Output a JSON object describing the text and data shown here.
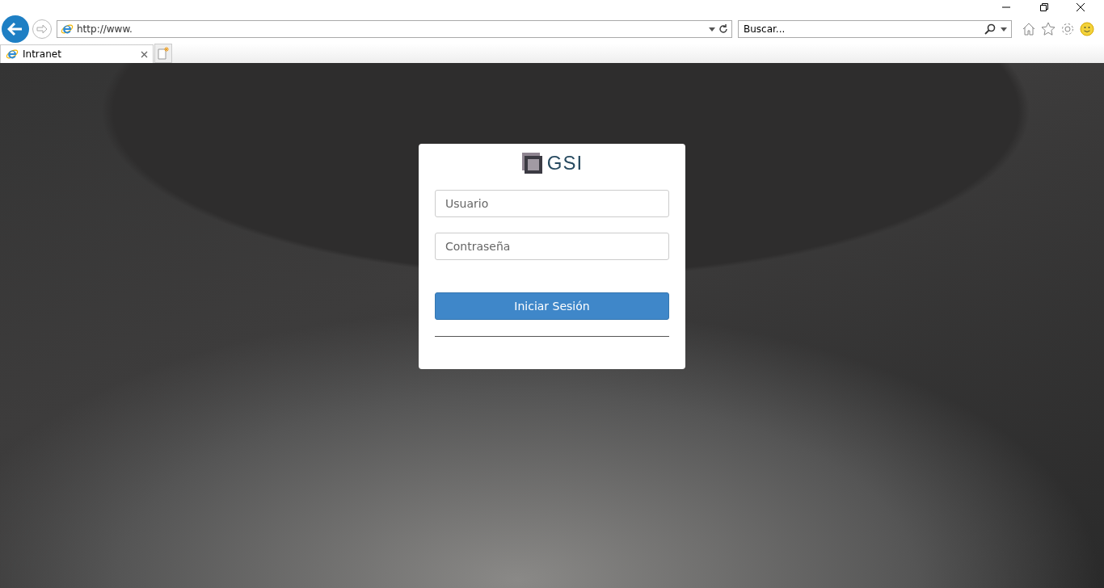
{
  "browser": {
    "address": "http://www.",
    "search": {
      "placeholder": "Buscar..."
    },
    "tabs": [
      {
        "label": "Intranet",
        "selected": true
      }
    ]
  },
  "login": {
    "logo_text": "GSI",
    "fields": [
      {
        "placeholder": "Usuario"
      },
      {
        "placeholder": "Contraseña"
      }
    ],
    "button": "Iniciar Sesión"
  }
}
